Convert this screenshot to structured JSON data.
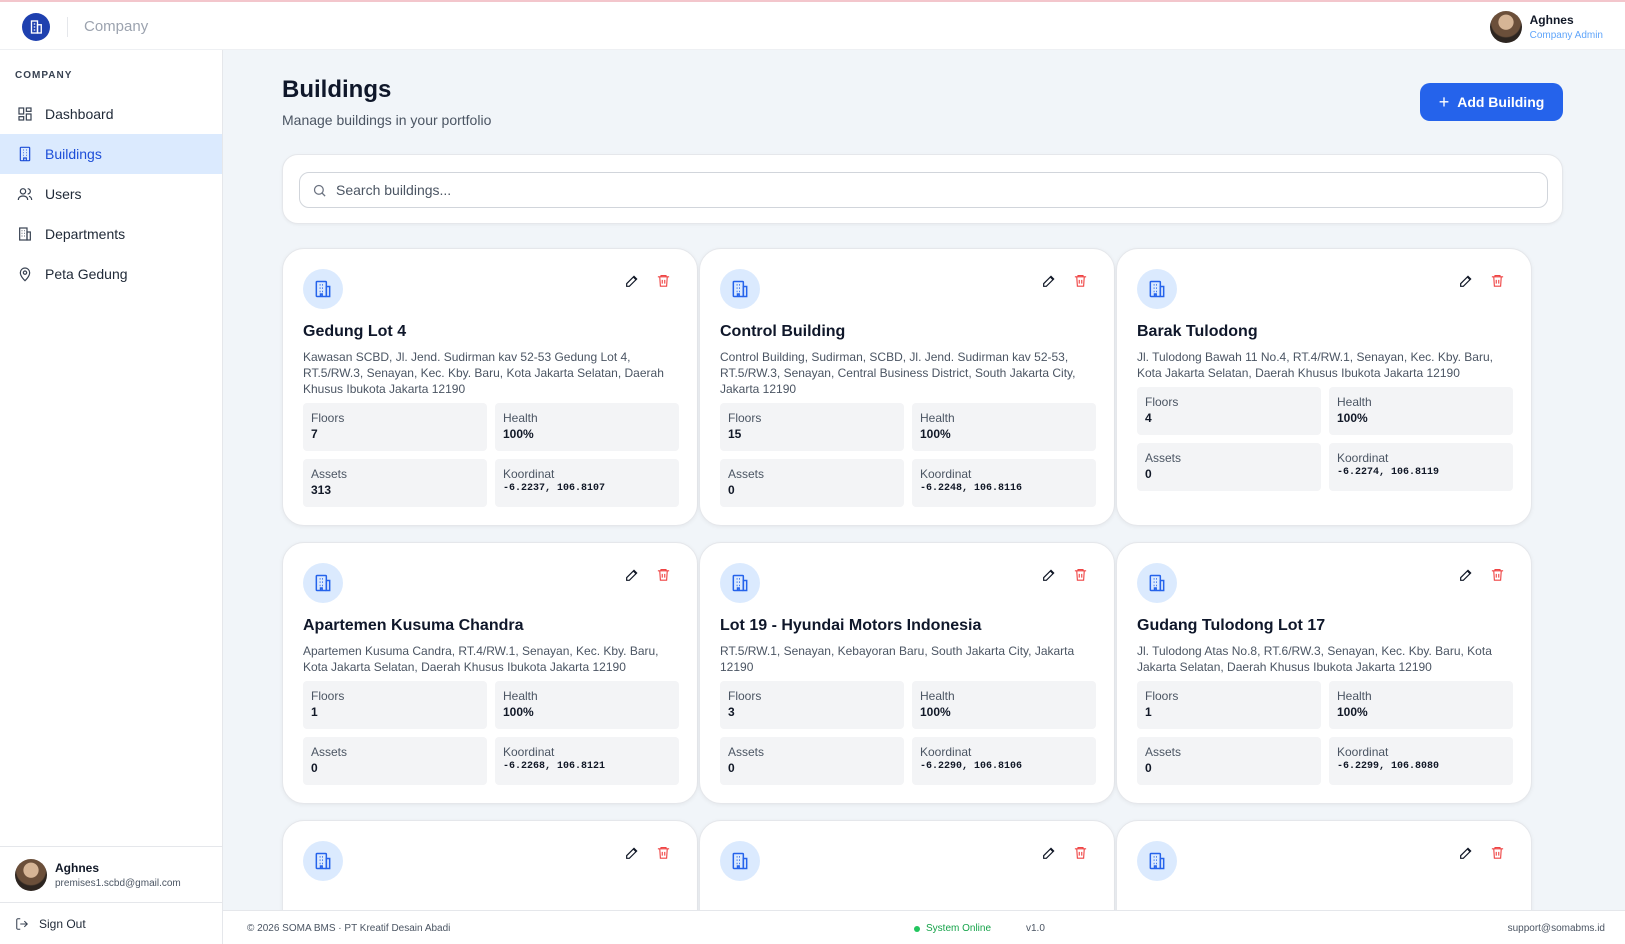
{
  "header": {
    "brand": "Company",
    "user_name": "Aghnes",
    "user_role": "Company Admin"
  },
  "sidebar": {
    "section_label": "COMPANY",
    "items": [
      {
        "label": "Dashboard",
        "icon": "dashboard-icon",
        "active": false
      },
      {
        "label": "Buildings",
        "icon": "building-icon",
        "active": true
      },
      {
        "label": "Users",
        "icon": "users-icon",
        "active": false
      },
      {
        "label": "Departments",
        "icon": "departments-icon",
        "active": false
      },
      {
        "label": "Peta Gedung",
        "icon": "map-pin-icon",
        "active": false
      }
    ],
    "user_name": "Aghnes",
    "user_email": "premises1.scbd@gmail.com",
    "signout_label": "Sign Out"
  },
  "page": {
    "title": "Buildings",
    "subtitle": "Manage buildings in your portfolio",
    "add_button": "Add Building",
    "search_placeholder": "Search buildings..."
  },
  "stat_labels": {
    "floors": "Floors",
    "health": "Health",
    "assets": "Assets",
    "koordinat": "Koordinat"
  },
  "buildings": [
    {
      "name": "Gedung Lot 4",
      "address": "Kawasan SCBD, Jl. Jend. Sudirman kav 52-53 Gedung Lot 4, RT.5/RW.3, Senayan, Kec. Kby. Baru, Kota Jakarta Selatan, Daerah Khusus Ibukota Jakarta 12190",
      "floors": "7",
      "health": "100%",
      "assets": "313",
      "koordinat": "-6.2237, 106.8107"
    },
    {
      "name": "Control Building",
      "address": "Control Building, Sudirman, SCBD, Jl. Jend. Sudirman kav 52-53, RT.5/RW.3, Senayan, Central Business District, South Jakarta City, Jakarta 12190",
      "floors": "15",
      "health": "100%",
      "assets": "0",
      "koordinat": "-6.2248, 106.8116"
    },
    {
      "name": "Barak Tulodong",
      "address": "Jl. Tulodong Bawah 11 No.4, RT.4/RW.1, Senayan, Kec. Kby. Baru, Kota Jakarta Selatan, Daerah Khusus Ibukota Jakarta 12190",
      "floors": "4",
      "health": "100%",
      "assets": "0",
      "koordinat": "-6.2274, 106.8119"
    },
    {
      "name": "Apartemen Kusuma Chandra",
      "address": "Apartemen Kusuma Candra, RT.4/RW.1, Senayan, Kec. Kby. Baru, Kota Jakarta Selatan, Daerah Khusus Ibukota Jakarta 12190",
      "floors": "1",
      "health": "100%",
      "assets": "0",
      "koordinat": "-6.2268, 106.8121"
    },
    {
      "name": "Lot 19 - Hyundai Motors Indonesia",
      "address": "RT.5/RW.1, Senayan, Kebayoran Baru, South Jakarta City, Jakarta 12190",
      "floors": "3",
      "health": "100%",
      "assets": "0",
      "koordinat": "-6.2290, 106.8106"
    },
    {
      "name": "Gudang Tulodong Lot 17",
      "address": "Jl. Tulodong Atas No.8, RT.6/RW.3, Senayan, Kec. Kby. Baru, Kota Jakarta Selatan, Daerah Khusus Ibukota Jakarta 12190",
      "floors": "1",
      "health": "100%",
      "assets": "0",
      "koordinat": "-6.2299, 106.8080"
    }
  ],
  "footer": {
    "copyright": "© 2026 SOMA BMS · PT Kreatif Desain Abadi",
    "status": "System Online",
    "version": "v1.0",
    "support": "support@somabms.id"
  },
  "colors": {
    "accent": "#2563eb",
    "active_bg": "#dbeafe",
    "danger": "#ef4444",
    "online": "#22c55e"
  }
}
